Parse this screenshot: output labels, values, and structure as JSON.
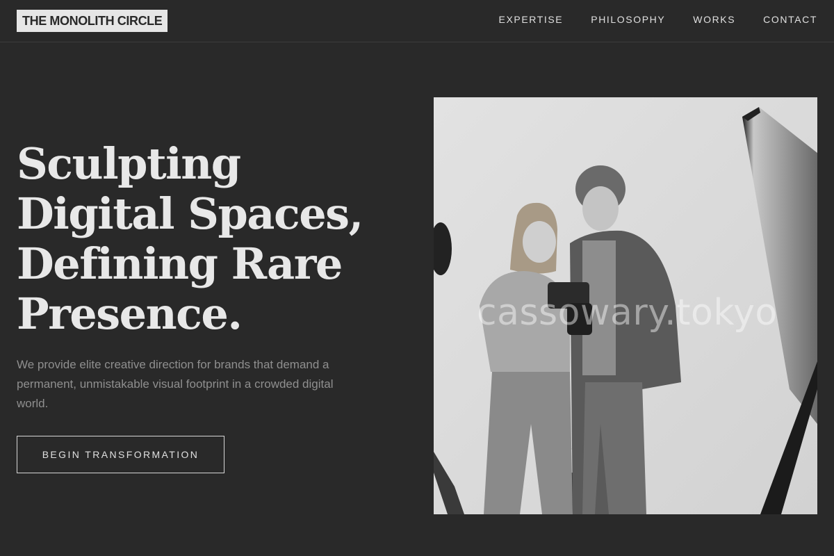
{
  "brand": {
    "name": "THE MONOLITH CIRCLE"
  },
  "nav": {
    "items": [
      {
        "label": "EXPERTISE"
      },
      {
        "label": "PHILOSOPHY"
      },
      {
        "label": "WORKS"
      },
      {
        "label": "CONTACT"
      }
    ]
  },
  "hero": {
    "title_lines": [
      "Sculpting",
      "Digital Spaces,",
      "Defining Rare",
      "Presence."
    ],
    "subtitle": "We provide elite creative direction for brands that demand a permanent, unmistakable visual footprint in a crowded digital world.",
    "cta_label": "BEGIN TRANSFORMATION"
  },
  "image": {
    "watermark": "cassowary.tokyo"
  },
  "colors": {
    "background": "#292929",
    "text": "#e6e6e6",
    "muted": "#8f8f8f",
    "logo_bg": "#e6e6e6"
  }
}
